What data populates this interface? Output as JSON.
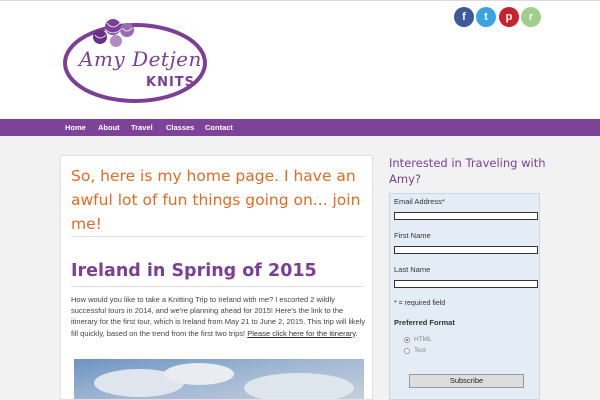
{
  "logo": {
    "name": "Amy Detjen",
    "sub": "KNITS"
  },
  "social": [
    {
      "name": "facebook-icon",
      "glyph": "f",
      "color": "#3b5b9b"
    },
    {
      "name": "twitter-icon",
      "glyph": "t",
      "color": "#3aa4e0"
    },
    {
      "name": "pinterest-icon",
      "glyph": "p",
      "color": "#c8232c"
    },
    {
      "name": "ravelry-icon",
      "glyph": "r",
      "color": "#9fcf8a"
    }
  ],
  "nav": [
    "Home",
    "About",
    "Travel",
    "Classes",
    "Contact"
  ],
  "main": {
    "intro": "So, here is my home page. I have an awful lot of fun things going on... join me!",
    "post_title": "Ireland in Spring of 2015",
    "post_body": "How would you like to take a Knitting Trip to Ireland with me? I escorted 2 wildly successful tours in 2014, and we're planning ahead for 2015! Here's the link to the itinerary for the first tour, which is Ireland from May 21 to June 2, 2015. This trip will likely fill quickly, based on the trend from the first two trips!",
    "post_link": "Please click here for the itinerary"
  },
  "sidebar": {
    "title": "Interested in Traveling with Amy?",
    "email_label": "Email Address*",
    "first_label": "First Name",
    "last_label": "Last Name",
    "required_note": "* = required field",
    "format_label": "Preferred Format",
    "format_options": [
      "HTML",
      "Text"
    ],
    "subscribe_label": "Subscribe"
  },
  "colors": {
    "brand_purple": "#7b3f98",
    "nav_purple": "#7c4398",
    "accent_orange": "#e46b23"
  }
}
